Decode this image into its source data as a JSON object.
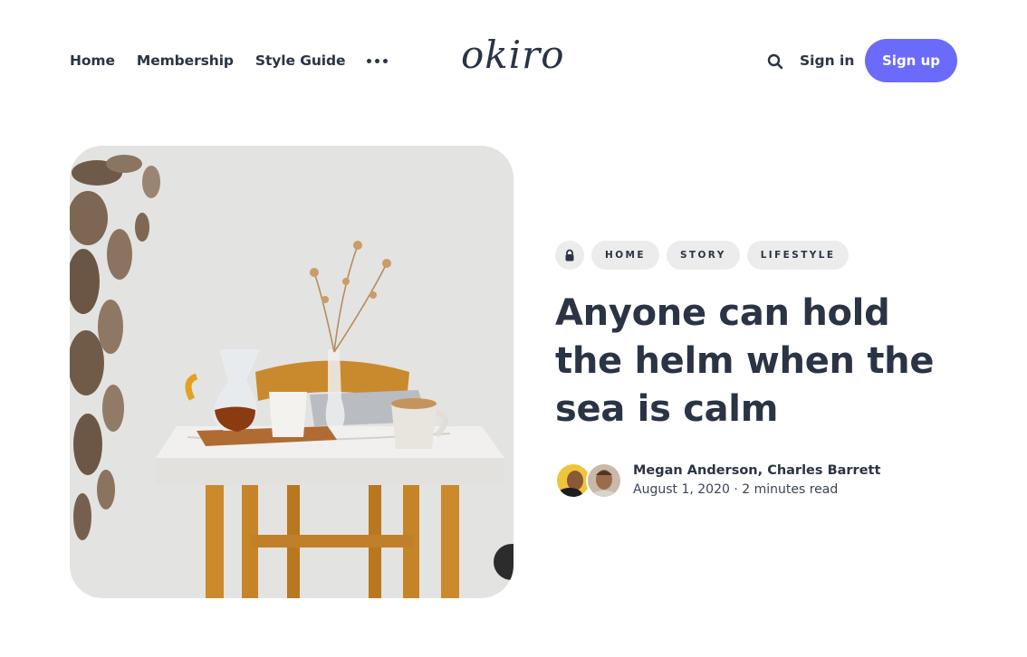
{
  "header": {
    "nav": [
      "Home",
      "Membership",
      "Style Guide"
    ],
    "logo": "okiro",
    "signin_label": "Sign in",
    "signup_label": "Sign up",
    "more_icon": "more-dots-icon",
    "search_icon": "search-icon"
  },
  "post": {
    "access_icon": "lock-icon",
    "tags": [
      "Home",
      "Story",
      "Lifestyle"
    ],
    "title": "Anyone can hold the helm when the sea is calm",
    "authors": [
      "Megan Anderson",
      "Charles Barrett"
    ],
    "date": "August 1, 2020",
    "reading_time": "2 minutes read"
  },
  "colors": {
    "accent": "#6a6bfb",
    "text": "#2b3445",
    "pill": "#ececec"
  }
}
